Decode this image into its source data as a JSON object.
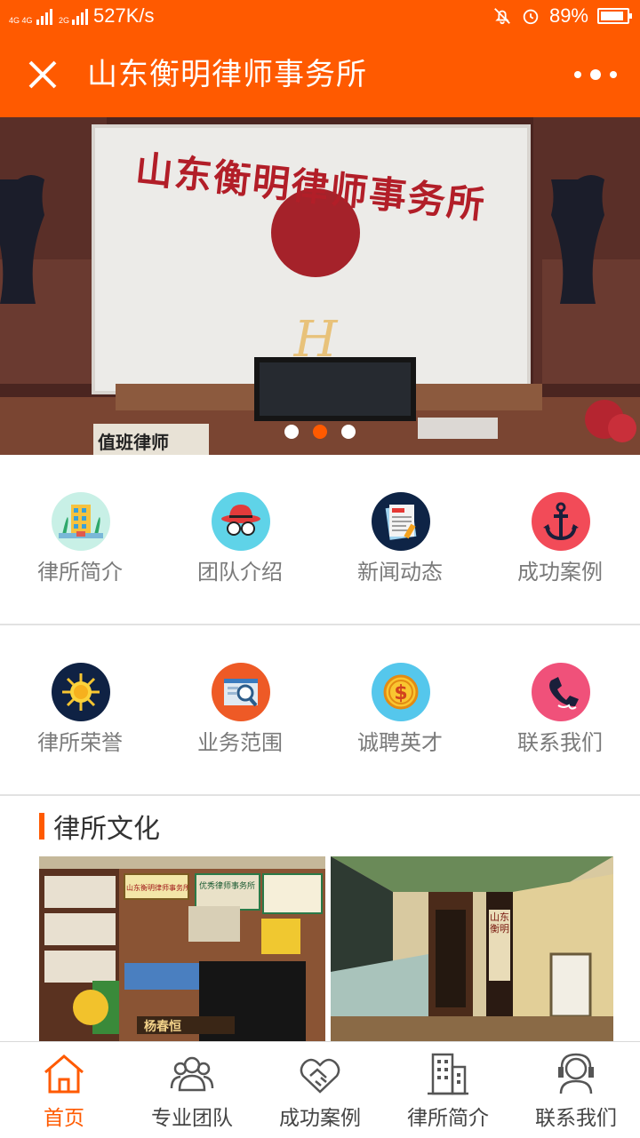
{
  "status": {
    "left_net1": "4G 4G",
    "left_net2": "2G",
    "speed": "527K/s",
    "battery": "89%",
    "battery_level": 0.89
  },
  "header": {
    "title": "山东衡明律师事务所"
  },
  "banner": {
    "sign_text": "山东衡明律师事务所",
    "desk_sign": "值班律师",
    "logo_letter": "H",
    "slide_count": 3,
    "active_slide": 1
  },
  "menu_row1": [
    {
      "label": "律所简介",
      "icon": "building-icon",
      "color": "#c8f0e6"
    },
    {
      "label": "团队介绍",
      "icon": "hat-glasses-icon",
      "color": "#5fd3e8"
    },
    {
      "label": "新闻动态",
      "icon": "newspaper-icon",
      "color": "#0e2446"
    },
    {
      "label": "成功案例",
      "icon": "anchor-icon",
      "color": "#f24b58"
    }
  ],
  "menu_row2": [
    {
      "label": "律所荣誉",
      "icon": "sun-icon",
      "color": "#0f2244"
    },
    {
      "label": "业务范围",
      "icon": "search-web-icon",
      "color": "#ee5a26"
    },
    {
      "label": "诚聘英才",
      "icon": "dollar-coin-icon",
      "color": "#55c7ec"
    },
    {
      "label": "联系我们",
      "icon": "phone-icon",
      "color": "#f0517a"
    }
  ],
  "culture": {
    "title": "律所文化",
    "photo1_text1": "优秀律师事务所",
    "photo1_text2": "山东衡明律师事务所",
    "photo1_name": "杨春恒",
    "photo2_text": "山东衡明"
  },
  "tabs": [
    {
      "label": "首页",
      "icon": "home-icon",
      "active": true
    },
    {
      "label": "专业团队",
      "icon": "team-icon",
      "active": false
    },
    {
      "label": "成功案例",
      "icon": "handshake-icon",
      "active": false
    },
    {
      "label": "律所简介",
      "icon": "office-building-icon",
      "active": false
    },
    {
      "label": "联系我们",
      "icon": "headset-icon",
      "active": false
    }
  ],
  "colors": {
    "accent": "#ff5a00"
  }
}
